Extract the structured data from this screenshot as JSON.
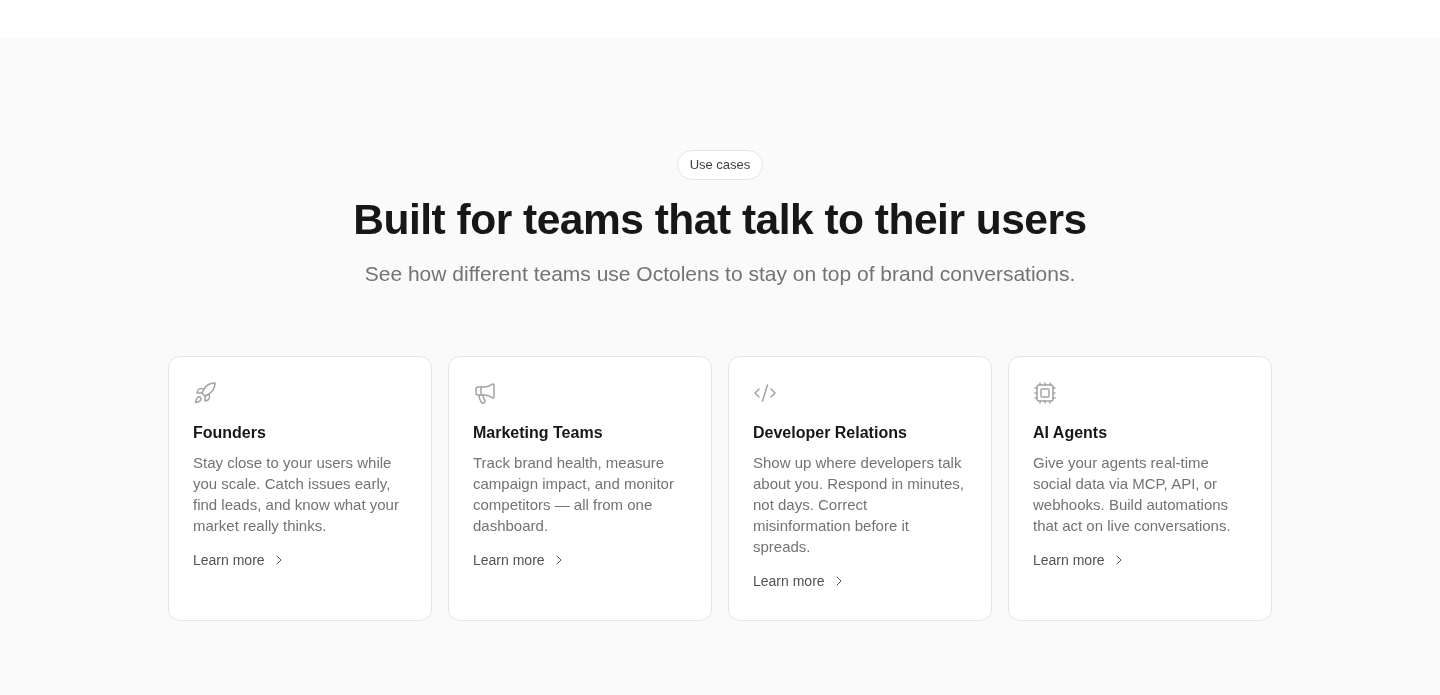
{
  "badge": "Use cases",
  "heading": "Built for teams that talk to their users",
  "subheading": "See how different teams use Octolens to stay on top of brand conversations.",
  "cards": [
    {
      "title": "Founders",
      "description": "Stay close to your users while you scale. Catch issues early, find leads, and know what your market really thinks.",
      "link": "Learn more"
    },
    {
      "title": "Marketing Teams",
      "description": "Track brand health, measure campaign impact, and monitor competitors — all from one dashboard.",
      "link": "Learn more"
    },
    {
      "title": "Developer Relations",
      "description": "Show up where developers talk about you. Respond in minutes, not days. Correct misinformation before it spreads.",
      "link": "Learn more"
    },
    {
      "title": "AI Agents",
      "description": "Give your agents real-time social data via MCP, API, or webhooks. Build automations that act on live conversations.",
      "link": "Learn more"
    }
  ]
}
